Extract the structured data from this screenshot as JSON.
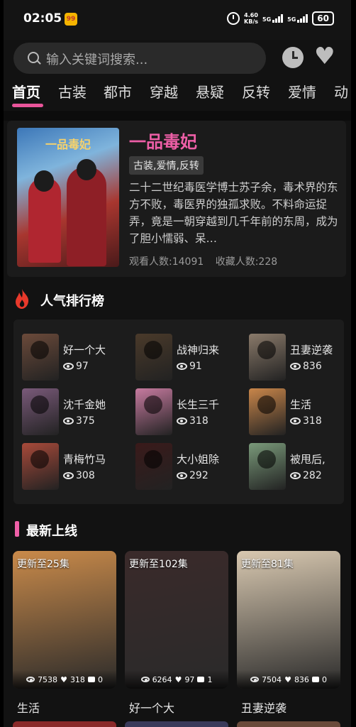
{
  "status_bar": {
    "time": "02:05",
    "app_badge": "99",
    "net_speed": "4.60\nKB/s",
    "net1": "5G",
    "net2": "5G",
    "battery": "60"
  },
  "search": {
    "placeholder": "输入关键词搜索..."
  },
  "header_icons": [
    "clock-icon",
    "heart-icon"
  ],
  "tabs": [
    {
      "label": "首页",
      "active": true
    },
    {
      "label": "古装"
    },
    {
      "label": "都市"
    },
    {
      "label": "穿越"
    },
    {
      "label": "悬疑"
    },
    {
      "label": "反转"
    },
    {
      "label": "爱情"
    },
    {
      "label": "动"
    }
  ],
  "featured": {
    "cover_text": "一品毒妃",
    "title": "一品毒妃",
    "tags": "古装,爱情,反转",
    "description": "二十二世纪毒医学博士苏子余，毒术界的东方不败，毒医界的独孤求败。不料命运捉弄，竟是一朝穿越到几千年前的东周，成为了胆小懦弱、呆…",
    "viewers": "观看人数:14091",
    "favorites": "收藏人数:228"
  },
  "ranking": {
    "title": "人气排行榜",
    "items": [
      {
        "name": "好一个大",
        "views": "97",
        "color": "#6b4a3a"
      },
      {
        "name": "战神归来",
        "views": "91",
        "color": "#4a3a2a"
      },
      {
        "name": "丑妻逆袭",
        "views": "836",
        "color": "#8a7a6a"
      },
      {
        "name": "沈千金她",
        "views": "375",
        "color": "#7a5a7a"
      },
      {
        "name": "长生三千",
        "views": "318",
        "color": "#c77ba0"
      },
      {
        "name": "生活",
        "views": "318",
        "color": "#c9864a"
      },
      {
        "name": "青梅竹马",
        "views": "308",
        "color": "#a84a3a"
      },
      {
        "name": "大小姐除",
        "views": "292",
        "color": "#3a1a1a"
      },
      {
        "name": "被甩后,",
        "views": "282",
        "color": "#7a9a7a"
      }
    ]
  },
  "new_releases": {
    "title": "最新上线",
    "items": [
      {
        "episodes": "更新至25集",
        "views": "7538",
        "likes": "318",
        "comments": "0",
        "name": "生活",
        "color": "#c98a4a"
      },
      {
        "episodes": "更新至102集",
        "views": "6264",
        "likes": "97",
        "comments": "1",
        "name": "好一个大",
        "color": "#3a2a2a"
      },
      {
        "episodes": "更新至81集",
        "views": "7504",
        "likes": "836",
        "comments": "0",
        "name": "丑妻逆袭",
        "color": "#d8c8b0"
      }
    ]
  }
}
